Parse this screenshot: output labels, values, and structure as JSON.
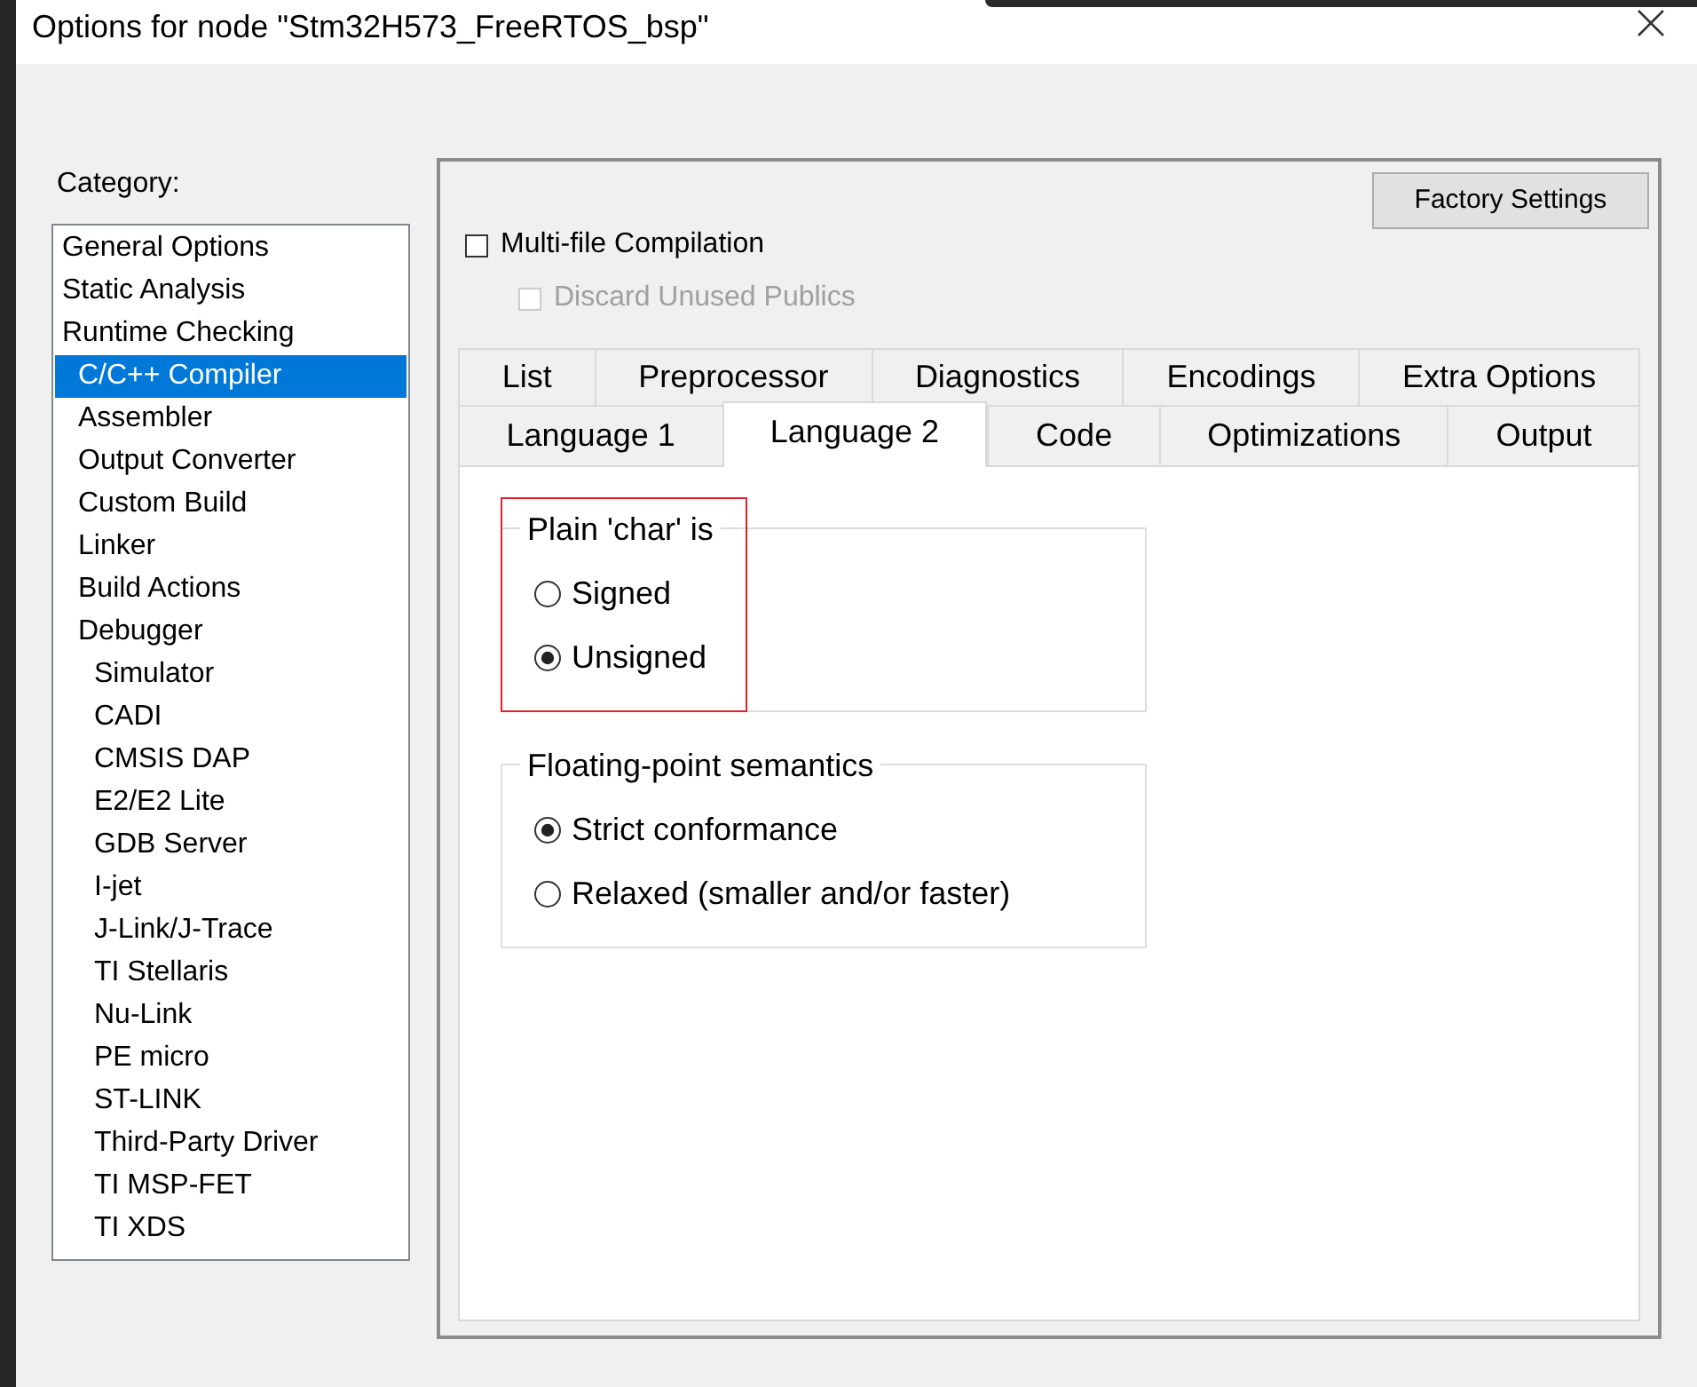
{
  "window": {
    "title": "Options for node \"Stm32H573_FreeRTOS_bsp\""
  },
  "category_list": {
    "label": "Category:",
    "items": [
      {
        "label": "General Options",
        "selected": false
      },
      {
        "label": "Static Analysis",
        "selected": false
      },
      {
        "label": "Runtime Checking",
        "selected": false,
        "children": [
          {
            "label": "C/C++ Compiler",
            "selected": true
          },
          {
            "label": "Assembler",
            "selected": false
          },
          {
            "label": "Output Converter",
            "selected": false
          },
          {
            "label": "Custom Build",
            "selected": false
          },
          {
            "label": "Linker",
            "selected": false
          },
          {
            "label": "Build Actions",
            "selected": false
          },
          {
            "label": "Debugger",
            "selected": false,
            "children": [
              {
                "label": "Simulator",
                "selected": false
              },
              {
                "label": "CADI",
                "selected": false
              },
              {
                "label": "CMSIS DAP",
                "selected": false
              },
              {
                "label": "E2/E2 Lite",
                "selected": false
              },
              {
                "label": "GDB Server",
                "selected": false
              },
              {
                "label": "I-jet",
                "selected": false
              },
              {
                "label": "J-Link/J-Trace",
                "selected": false
              },
              {
                "label": "TI Stellaris",
                "selected": false
              },
              {
                "label": "Nu-Link",
                "selected": false
              },
              {
                "label": "PE micro",
                "selected": false
              },
              {
                "label": "ST-LINK",
                "selected": false
              },
              {
                "label": "Third-Party Driver",
                "selected": false
              },
              {
                "label": "TI MSP-FET",
                "selected": false
              },
              {
                "label": "TI XDS",
                "selected": false
              }
            ]
          }
        ]
      }
    ]
  },
  "factory_settings_button": {
    "label": "Factory Settings"
  },
  "options": [
    {
      "label": "Multi-file Compilation",
      "checked": false,
      "disabled": false,
      "children": [
        {
          "label": "Discard Unused Publics",
          "checked": false,
          "disabled": true
        }
      ]
    }
  ],
  "tab_rows": [
    {
      "tabs": [
        {
          "label": "List",
          "selected": false
        },
        {
          "label": "Preprocessor",
          "selected": false
        },
        {
          "label": "Diagnostics",
          "selected": false
        },
        {
          "label": "Encodings",
          "selected": false
        },
        {
          "label": "Extra Options",
          "selected": false
        }
      ]
    },
    {
      "tabs": [
        {
          "label": "Language 1",
          "selected": false
        },
        {
          "label": "Language 2",
          "selected": true
        },
        {
          "label": "Code",
          "selected": false
        },
        {
          "label": "Optimizations",
          "selected": false
        },
        {
          "label": "Output",
          "selected": false
        }
      ]
    }
  ],
  "groups": [
    {
      "title": "Plain 'char' is",
      "highlighted": true,
      "options": [
        {
          "label": "Signed",
          "selected": false
        },
        {
          "label": "Unsigned",
          "selected": true
        }
      ]
    },
    {
      "title": "Floating-point semantics",
      "highlighted": false,
      "options": [
        {
          "label": "Strict conformance",
          "selected": true
        },
        {
          "label": "Relaxed (smaller and/or faster)",
          "selected": false
        }
      ]
    }
  ]
}
